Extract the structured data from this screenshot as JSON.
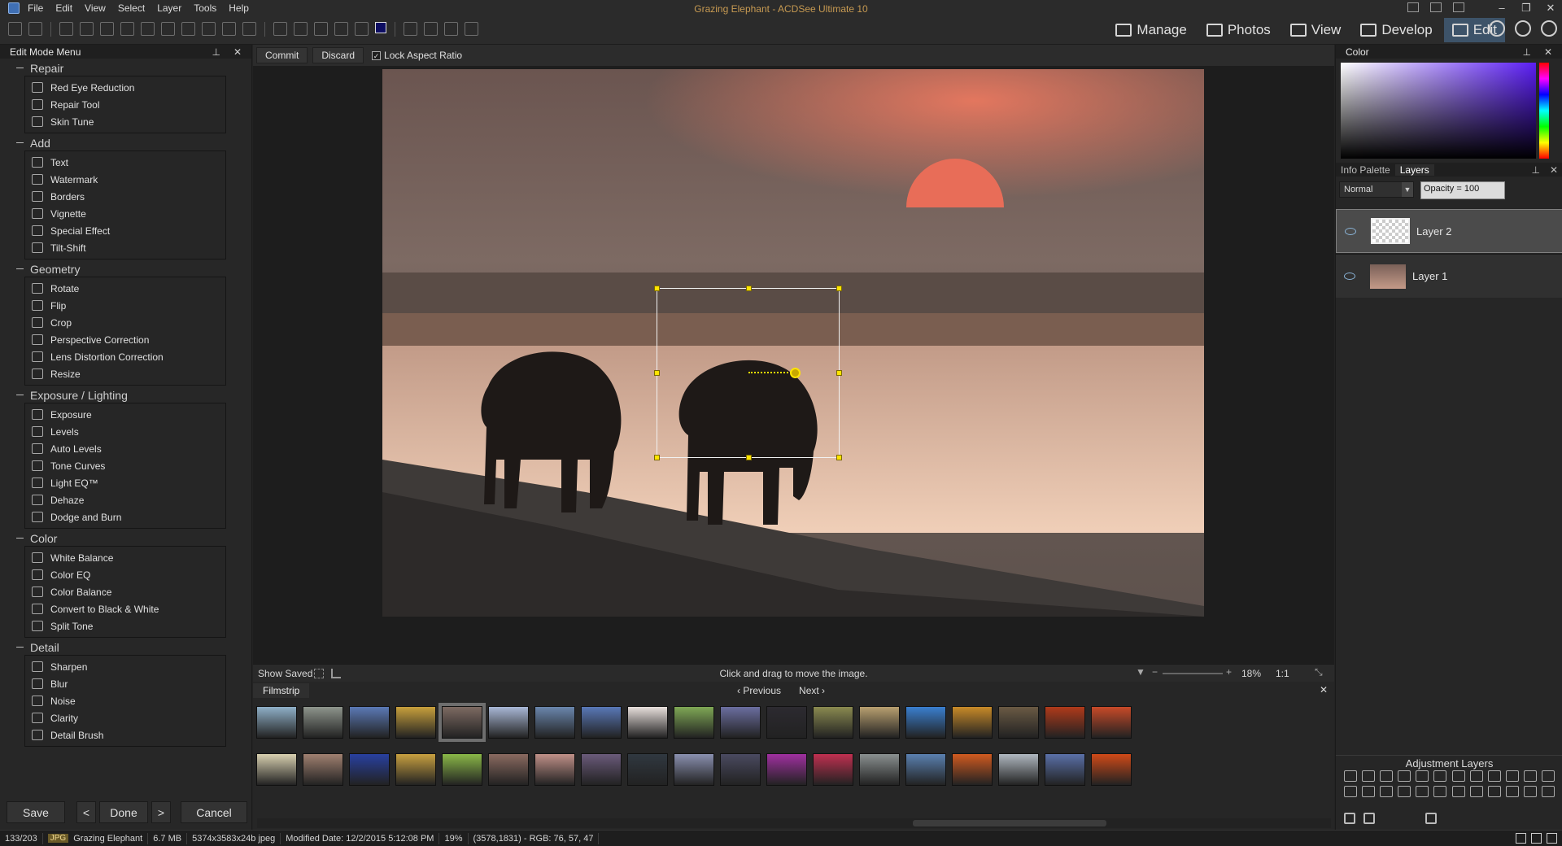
{
  "window": {
    "title": "Grazing Elephant - ACDSee Ultimate 10"
  },
  "menu": [
    "File",
    "Edit",
    "View",
    "Select",
    "Layer",
    "Tools",
    "Help"
  ],
  "modes": [
    {
      "label": "Manage",
      "icon": "grid-icon"
    },
    {
      "label": "Photos",
      "icon": "photos-icon"
    },
    {
      "label": "View",
      "icon": "eye-icon"
    },
    {
      "label": "Develop",
      "icon": "develop-icon"
    },
    {
      "label": "Edit",
      "icon": "edit-icon",
      "active": true
    }
  ],
  "left_panel": {
    "title": "Edit Mode Menu",
    "groups": [
      {
        "title": "Repair",
        "items": [
          "Red Eye Reduction",
          "Repair Tool",
          "Skin Tune"
        ]
      },
      {
        "title": "Add",
        "items": [
          "Text",
          "Watermark",
          "Borders",
          "Vignette",
          "Special Effect",
          "Tilt-Shift"
        ]
      },
      {
        "title": "Geometry",
        "items": [
          "Rotate",
          "Flip",
          "Crop",
          "Perspective Correction",
          "Lens Distortion Correction",
          "Resize"
        ]
      },
      {
        "title": "Exposure / Lighting",
        "items": [
          "Exposure",
          "Levels",
          "Auto Levels",
          "Tone Curves",
          "Light EQ™",
          "Dehaze",
          "Dodge and Burn"
        ]
      },
      {
        "title": "Color",
        "items": [
          "White Balance",
          "Color EQ",
          "Color Balance",
          "Convert to Black & White",
          "Split Tone"
        ]
      },
      {
        "title": "Detail",
        "items": [
          "Sharpen",
          "Blur",
          "Noise",
          "Clarity",
          "Detail Brush"
        ]
      }
    ],
    "buttons": {
      "save": "Save",
      "prev": "<",
      "done": "Done",
      "next": ">",
      "cancel": "Cancel"
    }
  },
  "commit_bar": {
    "commit": "Commit",
    "discard": "Discard",
    "lock_aspect": "Lock Aspect Ratio",
    "lock_checked": true
  },
  "image_status": {
    "show_saved": "Show Saved",
    "hint": "Click and drag to move the image.",
    "zoom": "18%",
    "ratio": "1:1"
  },
  "filmstrip": {
    "tab": "Filmstrip",
    "previous": "Previous",
    "next": "Next",
    "row1": [
      "#8fb0c8",
      "#8e958c",
      "#5b79b6",
      "#c8a03c",
      "#7d6a62",
      "#a9b8d6",
      "#6a86ad",
      "#5978b8",
      "#e8e0dc",
      "#7fa855",
      "#6b6ea0",
      "#2c2a30",
      "#8a8a50",
      "#b9a070",
      "#3a7fd0",
      "#c88a28",
      "#6a5a44",
      "#b03a1a",
      "#c84a28"
    ],
    "row2": [
      "#d8d0b0",
      "#a08070",
      "#2840a0",
      "#c8a040",
      "#8ab848",
      "#8a6a60",
      "#c09088",
      "#6a5a7a",
      "#303840",
      "#8a90b0",
      "#4a4a60",
      "#a030a0",
      "#c03050",
      "#8a9090",
      "#5a80b0",
      "#d05a20",
      "#b0b8c0",
      "#5a70a8",
      "#d04a18"
    ]
  },
  "right_panel": {
    "color_title": "Color",
    "tabs": [
      "Info Palette",
      "Layers"
    ],
    "active_tab": "Layers",
    "blend_mode": "Normal",
    "opacity": "Opacity = 100",
    "layers": [
      "Layer 2",
      "Layer 1"
    ],
    "adjustment_title": "Adjustment Layers"
  },
  "status": {
    "count": "133/203",
    "type": "JPG",
    "name": "Grazing Elephant",
    "size": "6.7 MB",
    "dims": "5374x3583x24b jpeg",
    "modified": "Modified Date: 12/2/2015 5:12:08 PM",
    "zoom": "19%",
    "pixel": "(3578,1831) - RGB: 76, 57, 47"
  },
  "colors": {
    "accent": "#3d5369",
    "title_text": "#c79a52",
    "handle": "#ffe400"
  }
}
